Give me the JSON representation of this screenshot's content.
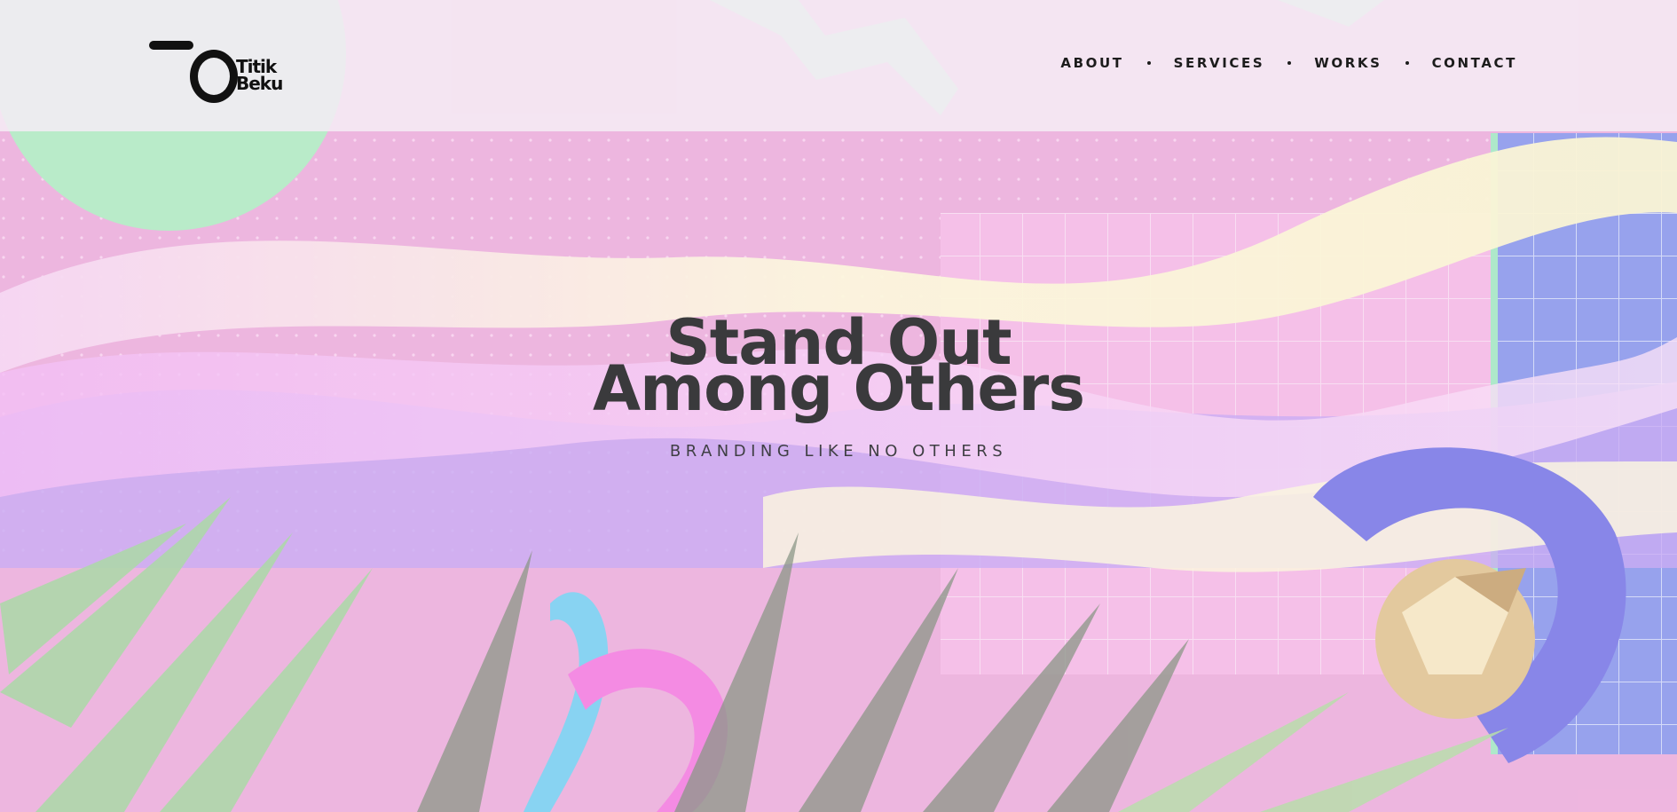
{
  "brand": {
    "logo_line1": "Titik",
    "logo_line2": "Beku"
  },
  "nav": {
    "items": [
      {
        "label": "ABOUT"
      },
      {
        "label": "SERVICES"
      },
      {
        "label": "WORKS"
      },
      {
        "label": "CONTACT"
      }
    ]
  },
  "hero": {
    "title_line1": "Stand Out",
    "title_line2": "Among Others",
    "subtitle": "BRANDING LIKE NO OTHERS"
  },
  "colors": {
    "background": "#e79ad3",
    "header": "#f5ecf4",
    "text": "#3a3a3c",
    "nav_text": "#1c1c1c"
  }
}
